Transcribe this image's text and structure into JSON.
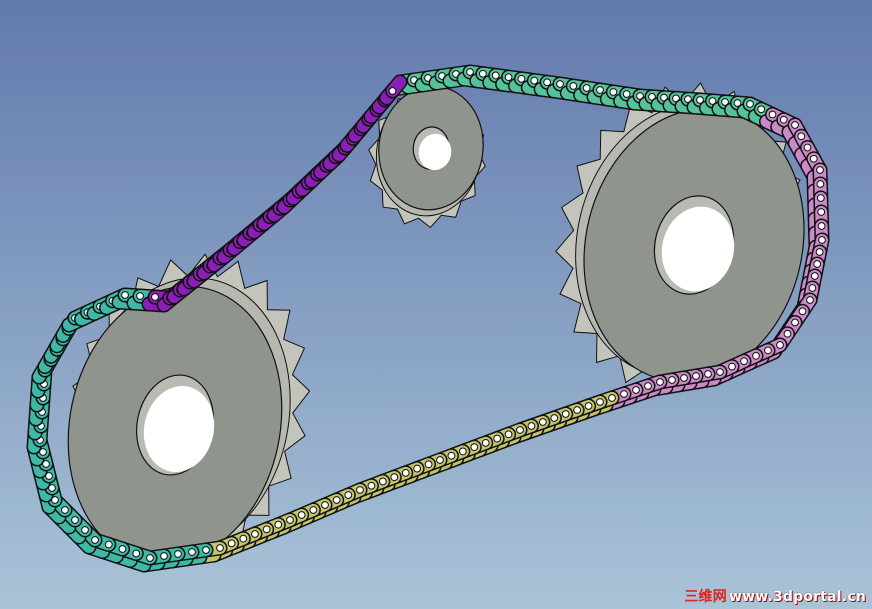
{
  "viewport": {
    "background_top": "#6279ad",
    "background_bottom": "#a9c4d8"
  },
  "colors": {
    "sprocket_face": "#8f948d",
    "sprocket_teeth": "#c3c5bc",
    "chain_teal": "#3fb8a6",
    "chain_green": "#56c29a",
    "chain_purple": "#8a1fb6",
    "chain_pink": "#c98ac7",
    "chain_olive": "#c4c46d",
    "outline": "#111111"
  },
  "watermark": {
    "cn_text": "三维网",
    "url_text": "www.3dportal.cn"
  }
}
